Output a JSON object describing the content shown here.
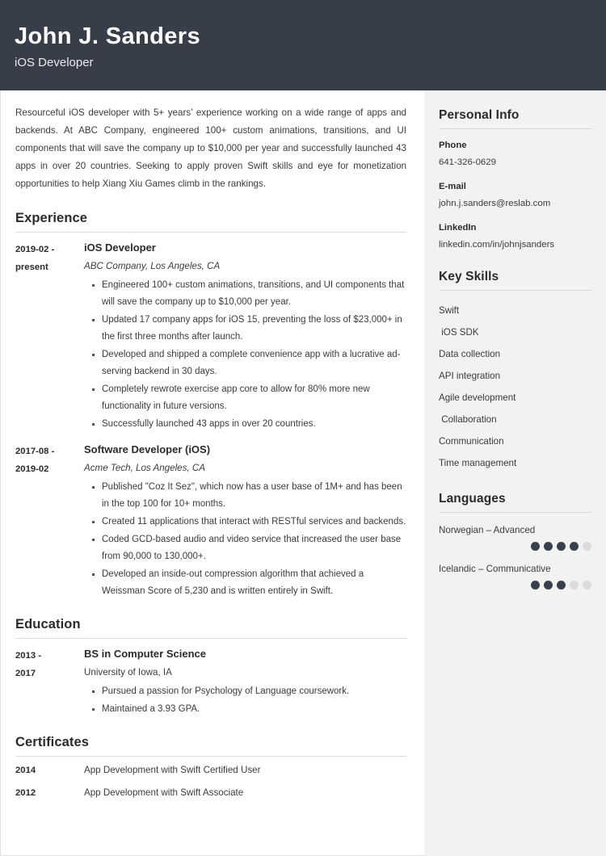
{
  "header": {
    "name": "John J. Sanders",
    "role": "iOS Developer"
  },
  "summary": "Resourceful iOS developer with 5+ years’ experience working on a wide range of apps and backends. At ABC Company, engineered 100+ custom animations, transitions, and UI components that will save the company up to $10,000 per year and successfully launched 43 apps in over 20 countries. Seeking to apply proven Swift skills and eye for monetization opportunities to help Xiang Xiu Games climb in the rankings.",
  "sections": {
    "experience_title": "Experience",
    "education_title": "Education",
    "certificates_title": "Certificates"
  },
  "experience": [
    {
      "date_from": "2019-02 -",
      "date_to": "present",
      "title": "iOS Developer",
      "org": "ABC Company, Los Angeles, CA",
      "bullets": [
        "Engineered 100+ custom animations, transitions, and UI components that will save the company up to $10,000 per year.",
        "Updated 17 company apps for iOS 15, preventing the loss of $23,000+ in the first three months after launch.",
        "Developed and shipped a complete convenience app with a lucrative ad-serving backend in 30 days.",
        "Completely rewrote exercise app core to allow for 80% more new functionality in future versions.",
        "Successfully launched 43 apps in over 20 countries."
      ]
    },
    {
      "date_from": "2017-08 -",
      "date_to": "2019-02",
      "title": "Software Developer (iOS)",
      "org": "Acme Tech, Los Angeles, CA",
      "bullets": [
        "Published \"Coz It Sez\", which now has a user base of 1M+ and has been in the top 100 for 10+ months.",
        "Created 11 applications that interact with RESTful services and backends.",
        "Coded GCD-based audio and video service that increased the user base from 90,000 to 130,000+.",
        "Developed an inside-out compression algorithm that achieved a Weissman Score of 5,230 and is written entirely in Swift."
      ]
    }
  ],
  "education": [
    {
      "date_from": "2013 -",
      "date_to": "2017",
      "title": "BS in Computer Science",
      "org": "University of Iowa, IA",
      "bullets": [
        "Pursued a passion for Psychology of Language coursework.",
        "Maintained a 3.93 GPA."
      ]
    }
  ],
  "certificates": [
    {
      "year": "2014",
      "name": "App Development with Swift Certified User"
    },
    {
      "year": "2012",
      "name": "App Development with Swift Associate"
    }
  ],
  "sidebar": {
    "personal_info_title": "Personal Info",
    "contacts": [
      {
        "label": "Phone",
        "value": "641-326-0629"
      },
      {
        "label": "E-mail",
        "value": "john.j.sanders@reslab.com"
      },
      {
        "label": "LinkedIn",
        "value": "linkedin.com/in/johnjsanders"
      }
    ],
    "key_skills_title": "Key Skills",
    "skills": [
      "Swift",
      " iOS SDK",
      "Data collection",
      "API integration",
      "Agile development",
      " Collaboration",
      "Communication",
      "Time management"
    ],
    "languages_title": "Languages",
    "languages": [
      {
        "name": "Norwegian – Advanced",
        "level": 4,
        "max": 5
      },
      {
        "name": "Icelandic – Communicative",
        "level": 3,
        "max": 5
      }
    ]
  },
  "colors": {
    "header_bg": "#383d4a",
    "sidebar_bg": "#f2f2f2",
    "text": "#3b3b3b",
    "heading": "#2b2b2b",
    "dot_filled": "#3a3f4c",
    "dot_empty": "#dcdcdc",
    "rule": "#dcdcdc"
  }
}
